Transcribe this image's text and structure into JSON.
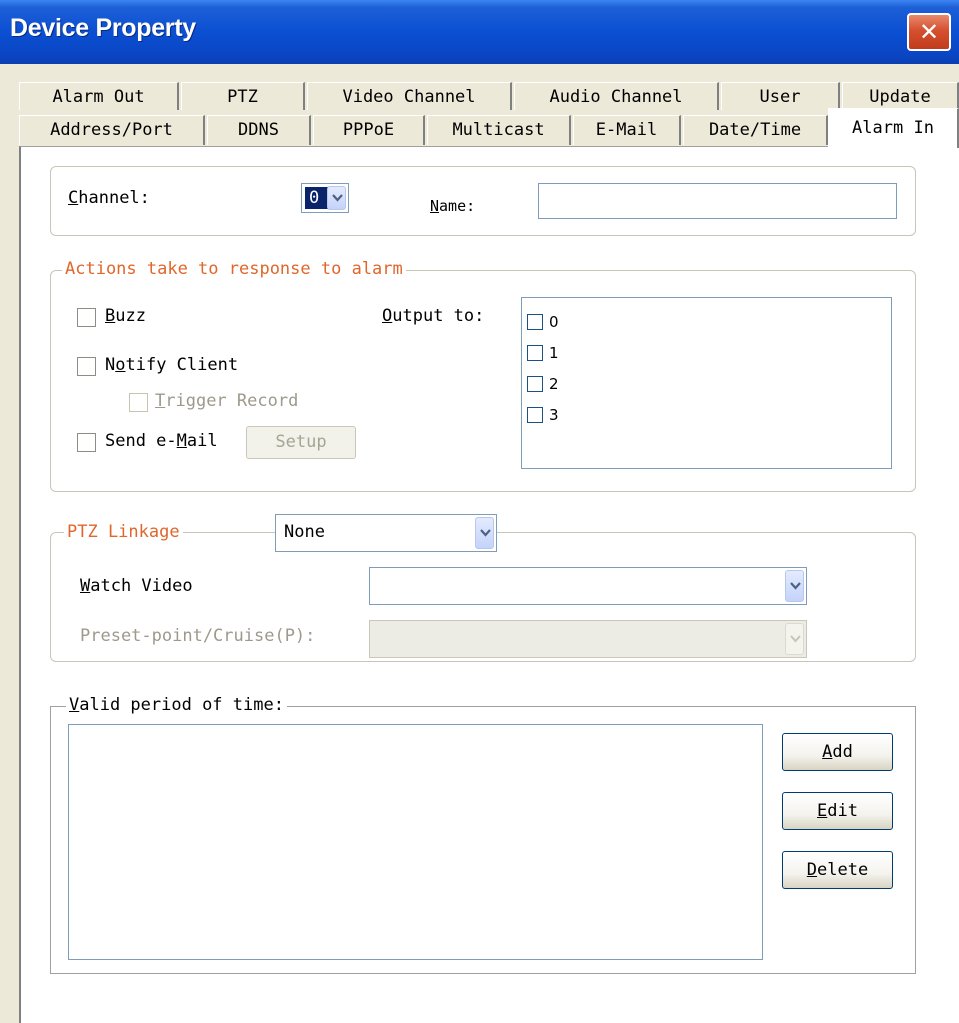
{
  "window": {
    "title": "Device Property",
    "close_label": "✕"
  },
  "tabs_row1": [
    "Alarm Out",
    "PTZ",
    "Video Channel",
    "Audio Channel",
    "User",
    "Update"
  ],
  "tabs_row2": [
    "Address/Port",
    "DDNS",
    "PPPoE",
    "Multicast",
    "E-Mail",
    "Date/Time",
    "Alarm In"
  ],
  "active_tab": "Alarm In",
  "channel": {
    "label": "Channel:",
    "value": "0",
    "name_label": "Name:",
    "name_value": ""
  },
  "actions": {
    "legend": "Actions take to response to alarm",
    "buzz": "Buzz",
    "notify_client": "Notify Client",
    "trigger_record": "Trigger Record",
    "send_email": "Send e-Mail",
    "setup": "Setup",
    "output_to": "Output to:",
    "outputs": [
      "0",
      "1",
      "2",
      "3"
    ]
  },
  "ptz": {
    "legend": "PTZ Linkage",
    "selected": "None",
    "watch_video_label": "Watch Video",
    "watch_video_value": "",
    "preset_label": "Preset-point/Cruise(P):",
    "preset_value": ""
  },
  "valid_period": {
    "legend": "Valid period of time:",
    "items": [],
    "add": "Add",
    "edit": "Edit",
    "delete": "Delete"
  },
  "colors": {
    "accent_orange": "#e0662a",
    "title_blue": "#0b4fd3",
    "dialog_bg": "#ece9d8"
  }
}
